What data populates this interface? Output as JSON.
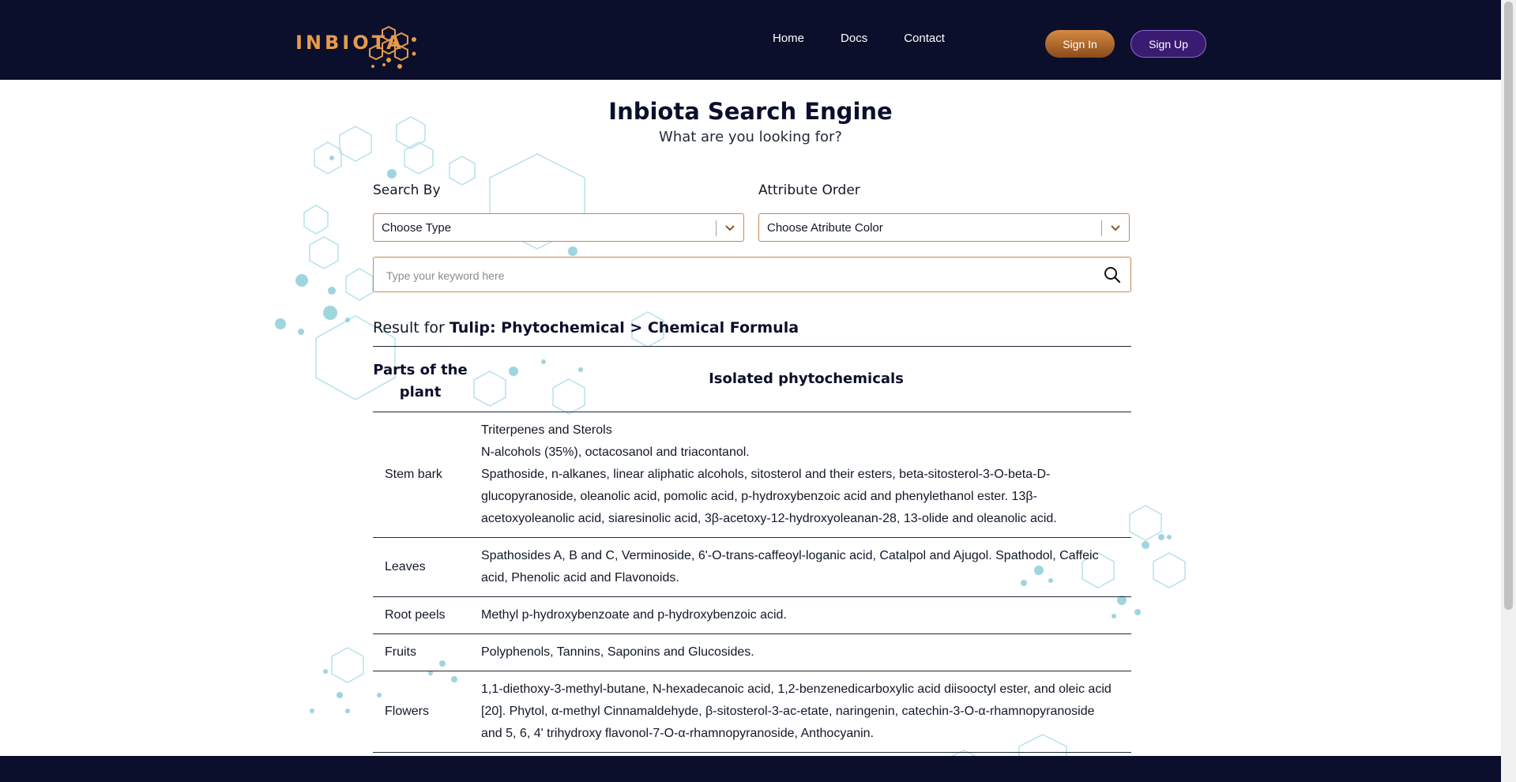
{
  "brand": {
    "logo_text": "INBIOTA"
  },
  "nav": {
    "items": [
      "Home",
      "Docs",
      "Contact"
    ]
  },
  "auth": {
    "signin": "Sign In",
    "signup": "Sign Up"
  },
  "hero": {
    "title": "Inbiota Search Engine",
    "subtitle": "What are you looking for?"
  },
  "filters": {
    "search_by_label": "Search By",
    "search_by_value": "Choose Type",
    "attribute_label": "Attribute Order",
    "attribute_value": "Choose Atribute Color"
  },
  "search": {
    "placeholder": "Type your keyword here",
    "value": ""
  },
  "result": {
    "prefix": "Result for ",
    "query": "Tulip: Phytochemical > Chemical Formula"
  },
  "table": {
    "headers": {
      "part": "Parts of the plant",
      "isolated": "Isolated phytochemicals"
    },
    "rows": [
      {
        "part": "Stem bark",
        "isolated": [
          "Triterpenes and Sterols",
          "N-alcohols (35%), octacosanol and triacontanol.",
          "Spathoside, n-alkanes, linear aliphatic alcohols, sitosterol and their esters, beta-sitosterol-3-O-beta-D-glucopyranoside, oleanolic acid, pomolic acid, p-hydroxybenzoic acid and phenylethanol ester. 13β-acetoxyoleanolic acid, siaresinolic acid, 3β-acetoxy-12-hydroxyoleanan-28, 13-olide and oleanolic acid."
        ]
      },
      {
        "part": "Leaves",
        "isolated": [
          "Spathosides A, B and C, Verminoside, 6'-O-trans-caffeoyl-loganic acid, Catalpol and Ajugol. Spathodol, Caffeic acid, Phenolic acid and Flavonoids."
        ]
      },
      {
        "part": "Root peels",
        "isolated": [
          "Methyl p-hydroxybenzoate and p-hydroxybenzoic acid."
        ]
      },
      {
        "part": "Fruits",
        "isolated": [
          "Polyphenols, Tannins, Saponins and Glucosides."
        ]
      },
      {
        "part": "Flowers",
        "isolated": [
          "1,1-diethoxy-3-methyl-butane, N-hexadecanoic acid, 1,2-benzenedicarboxylic acid diisooctyl ester, and oleic acid [20]. Phytol, α-methyl Cinnamaldehyde, β-sitosterol-3-ac-etate, naringenin, catechin-3-O-α-rhamnopyranoside and 5, 6, 4' trihydroxy flavonol-7-O-α-rhamnopyranoside, Anthocyanin."
        ]
      }
    ]
  },
  "colors": {
    "navy": "#0b0f2b",
    "accent_orange": "#c58a52",
    "signup_purple": "#3a1b72",
    "deco_teal": "#8fd3df"
  },
  "icons": {
    "search": "search-icon",
    "chevron": "chevron-down-icon"
  }
}
